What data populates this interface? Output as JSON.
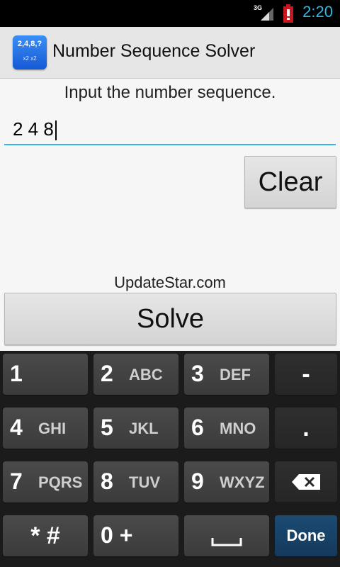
{
  "status_bar": {
    "network": "3G",
    "time": "2:20",
    "accent_color": "#33b5e5"
  },
  "action_bar": {
    "app_icon_text": "2,4,8,?",
    "app_icon_sub": "x2 x2",
    "title": "Number Sequence Solver"
  },
  "main": {
    "prompt": "Input the number sequence.",
    "input_value": "2 4 8",
    "clear_label": "Clear",
    "watermark": "UpdateStar.com",
    "solve_label": "Solve"
  },
  "keyboard": {
    "keys": [
      {
        "num": "1",
        "letters": ""
      },
      {
        "num": "2",
        "letters": "ABC"
      },
      {
        "num": "3",
        "letters": "DEF"
      },
      {
        "num": "-",
        "letters": ""
      },
      {
        "num": "4",
        "letters": "GHI"
      },
      {
        "num": "5",
        "letters": "JKL"
      },
      {
        "num": "6",
        "letters": "MNO"
      },
      {
        "num": ".",
        "letters": ""
      },
      {
        "num": "7",
        "letters": "PQRS"
      },
      {
        "num": "8",
        "letters": "TUV"
      },
      {
        "num": "9",
        "letters": "WXYZ"
      },
      {
        "num": "* #",
        "letters": ""
      },
      {
        "num": "0 +",
        "letters": ""
      },
      {
        "num": "",
        "letters": ""
      },
      {
        "num": "Done",
        "letters": ""
      }
    ],
    "icons": {
      "backspace": "backspace-icon",
      "space": "space-bar-icon"
    }
  }
}
